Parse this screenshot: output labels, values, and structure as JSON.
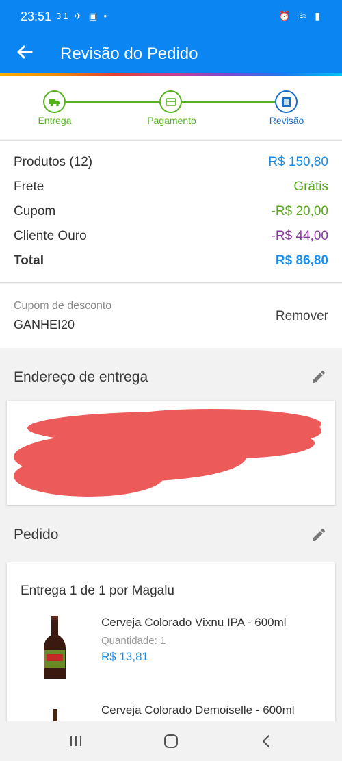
{
  "status_bar": {
    "time": "23:51",
    "notifications": "31 ✈ ▣ •",
    "system_icons": "⏰ ≋ ▮"
  },
  "app_bar": {
    "back_icon": "arrow-left-icon",
    "title": "Revisão do Pedido"
  },
  "colors": {
    "primary": "#0a85f2",
    "step_green": "#56b21c",
    "step_blue": "#1a6ec8",
    "price_blue": "#1a8de8",
    "green": "#5aa81e",
    "purple": "#8a3aa0"
  },
  "stepper": {
    "steps": [
      {
        "label": "Entrega",
        "icon": "truck-icon",
        "state": "done"
      },
      {
        "label": "Pagamento",
        "icon": "card-icon",
        "state": "done"
      },
      {
        "label": "Revisão",
        "icon": "list-icon",
        "state": "current"
      }
    ]
  },
  "summary": {
    "products_label": "Produtos (12)",
    "products_value": "R$ 150,80",
    "shipping_label": "Frete",
    "shipping_value": "Grátis",
    "coupon_label": "Cupom",
    "coupon_value": "-R$ 20,00",
    "gold_label": "Cliente Ouro",
    "gold_value": "-R$ 44,00",
    "total_label": "Total",
    "total_value": "R$ 86,80"
  },
  "coupon": {
    "label": "Cupom de desconto",
    "code": "GANHEI20",
    "remove_label": "Remover"
  },
  "address": {
    "title": "Endereço de entrega",
    "edit_icon": "pencil-icon"
  },
  "order": {
    "title": "Pedido",
    "edit_icon": "pencil-icon",
    "delivery_label": "Entrega 1 de 1 por Magalu",
    "products": [
      {
        "name": "Cerveja Colorado Vixnu IPA - 600ml",
        "quantity": "Quantidade:  1",
        "price": "R$ 13,81"
      },
      {
        "name": "Cerveja Colorado Demoiselle - 600ml",
        "quantity": "",
        "price": ""
      }
    ]
  },
  "nav_bar": {
    "recents_icon": "recents-icon",
    "home_icon": "home-icon",
    "back_icon": "back-chevron-icon"
  }
}
